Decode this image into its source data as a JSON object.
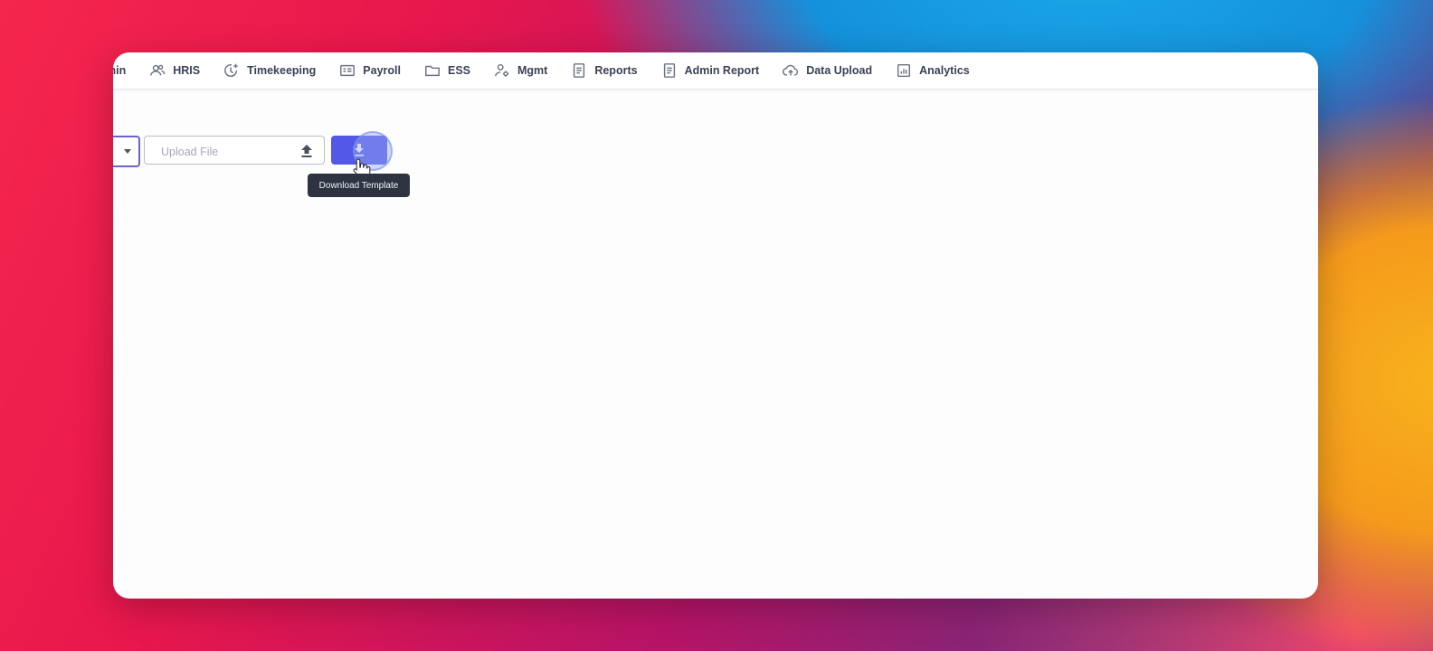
{
  "nav": {
    "items": [
      {
        "label": "min",
        "icon": "user-shield-icon"
      },
      {
        "label": "HRIS",
        "icon": "users-icon"
      },
      {
        "label": "Timekeeping",
        "icon": "clock-plus-icon"
      },
      {
        "label": "Payroll",
        "icon": "payroll-card-icon"
      },
      {
        "label": "ESS",
        "icon": "folder-icon"
      },
      {
        "label": "Mgmt",
        "icon": "user-gear-icon"
      },
      {
        "label": "Reports",
        "icon": "document-icon"
      },
      {
        "label": "Admin Report",
        "icon": "document-icon"
      },
      {
        "label": "Data Upload",
        "icon": "cloud-upload-icon"
      },
      {
        "label": "Analytics",
        "icon": "chart-icon"
      }
    ]
  },
  "upload": {
    "placeholder": "Upload File"
  },
  "tooltip": {
    "text": "Download Template"
  },
  "colors": {
    "accent": "#5458e8",
    "select_border": "#6a63c9",
    "tooltip_bg": "#2d3340"
  }
}
